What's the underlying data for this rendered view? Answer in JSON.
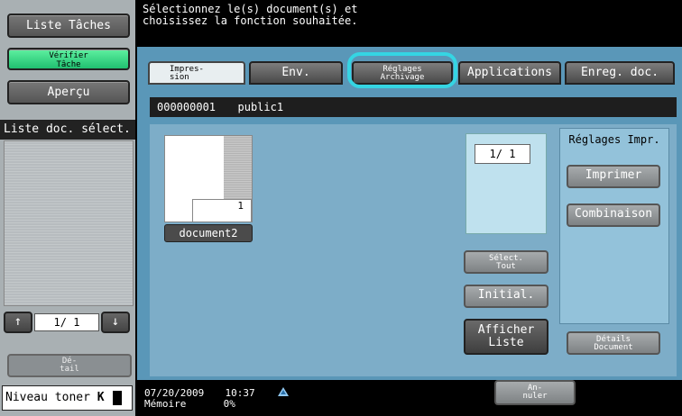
{
  "sidebar": {
    "task_list_label": "Liste Tâches",
    "check_job_label": "Vérifier Tâche",
    "preview_label": "Aperçu",
    "selected_docs_header": "Liste doc. sélect.",
    "page_indicator": "1/ 1",
    "detail_label": "Dé- tail",
    "toner_label": "Niveau toner",
    "toner_color": "K"
  },
  "header": {
    "instruction_line1": "Sélectionnez le(s) document(s) et",
    "instruction_line2": "choisissez la fonction souhaitée."
  },
  "tabs": [
    {
      "label": "Impres- sion",
      "active": true
    },
    {
      "label": "Env.",
      "active": false
    },
    {
      "label": "Réglages Archivage",
      "active": false,
      "highlighted": true
    },
    {
      "label": "Applications",
      "active": false
    },
    {
      "label": "Enreg. doc.",
      "active": false
    }
  ],
  "job_bar": {
    "box_number": "000000001",
    "box_name": "public1"
  },
  "document": {
    "name": "document2",
    "thumbnail_number": "1"
  },
  "page_count": "1/ 1",
  "buttons": {
    "select_all": "Sélect. Tout",
    "reset": "Initial.",
    "show_list": "Afficher Liste",
    "doc_details": "Détails Document",
    "cancel": "An- nuler"
  },
  "print_settings": {
    "title": "Réglages Impr.",
    "print": "Imprimer",
    "combine": "Combinaison"
  },
  "status": {
    "date": "07/20/2009",
    "time": "10:37",
    "memory_label": "Mémoire",
    "memory_value": "0%"
  },
  "colors": {
    "panel_blue": "#5a97b8",
    "highlight_cyan": "#35d5e3",
    "green_button": "#20c070"
  }
}
